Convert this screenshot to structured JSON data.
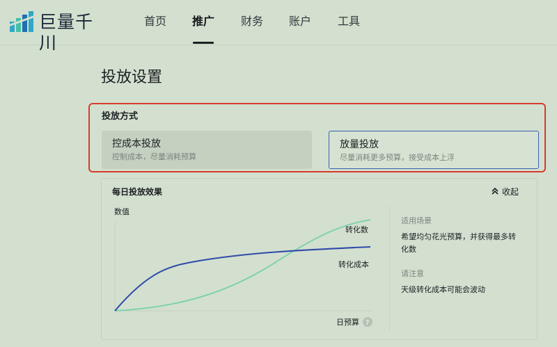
{
  "app": {
    "brand_name": "巨量千川",
    "logo_colors": [
      "#2ea8c6",
      "#45bfa8",
      "#1f6fb2"
    ]
  },
  "nav": {
    "items": [
      {
        "label": "首页",
        "active": false
      },
      {
        "label": "推广",
        "active": true
      },
      {
        "label": "财务",
        "active": false
      },
      {
        "label": "账户",
        "active": false
      },
      {
        "label": "工具",
        "active": false
      }
    ]
  },
  "page": {
    "title": "投放设置"
  },
  "delivery_mode": {
    "label": "投放方式",
    "highlight_color": "#d83a2c",
    "options": [
      {
        "title": "控成本投放",
        "description": "控制成本，尽量消耗预算",
        "selected": false
      },
      {
        "title": "放量投放",
        "description": "尽量消耗更多预算，接受成本上浮",
        "selected": true
      }
    ]
  },
  "effect_panel": {
    "title": "每日投放效果",
    "collapse_label": "收起",
    "collapse_icon": "chevron-double-up-icon",
    "chart": {
      "y_label": "数值",
      "x_label": "日预算",
      "help_icon": "question-circle-icon",
      "series": [
        {
          "label": "转化数",
          "color": "#7fd1b0"
        },
        {
          "label": "转化成本",
          "color": "#2e4aa8"
        }
      ]
    },
    "info": {
      "scenario_label": "适用场景",
      "scenario_text": "希望均匀花光预算，并获得最多转化数",
      "notice_label": "请注意",
      "notice_text": "天级转化成本可能会波动"
    }
  }
}
